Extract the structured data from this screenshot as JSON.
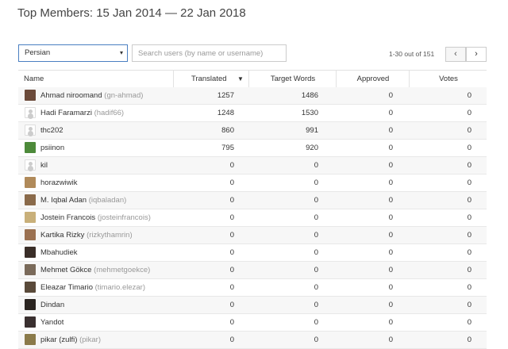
{
  "title": "Top Members: 15 Jan 2014 — 22 Jan 2018",
  "language_select": {
    "value": "Persian",
    "caret": "▾"
  },
  "search": {
    "placeholder": "Search users (by name or username)"
  },
  "pagination": {
    "text": "1-30 out of 151",
    "prev": "‹",
    "next": "›"
  },
  "columns": {
    "name": "Name",
    "translated": "Translated",
    "sort_indicator": "▼",
    "target_words": "Target Words",
    "approved": "Approved",
    "votes": "Votes"
  },
  "members": [
    {
      "name": "Ahmad niroomand",
      "username": "(gn-ahmad)",
      "translated": "1257",
      "target_words": "1486",
      "approved": "0",
      "votes": "0",
      "avatar_color": "#6b4a3a"
    },
    {
      "name": "Hadi Faramarzi",
      "username": "(hadif66)",
      "translated": "1248",
      "target_words": "1530",
      "approved": "0",
      "votes": "0",
      "avatar_color": "default"
    },
    {
      "name": "thc202",
      "username": "",
      "translated": "860",
      "target_words": "991",
      "approved": "0",
      "votes": "0",
      "avatar_color": "default"
    },
    {
      "name": "psiinon",
      "username": "",
      "translated": "795",
      "target_words": "920",
      "approved": "0",
      "votes": "0",
      "avatar_color": "#4d8a3a"
    },
    {
      "name": "kil",
      "username": "",
      "translated": "0",
      "target_words": "0",
      "approved": "0",
      "votes": "0",
      "avatar_color": "default"
    },
    {
      "name": "horazwiwik",
      "username": "",
      "translated": "0",
      "target_words": "0",
      "approved": "0",
      "votes": "0",
      "avatar_color": "#b08a5a"
    },
    {
      "name": "M. Iqbal Adan",
      "username": "(iqbaladan)",
      "translated": "0",
      "target_words": "0",
      "approved": "0",
      "votes": "0",
      "avatar_color": "#8a6a4a"
    },
    {
      "name": "Jostein Francois",
      "username": "(josteinfrancois)",
      "translated": "0",
      "target_words": "0",
      "approved": "0",
      "votes": "0",
      "avatar_color": "#c9b07a"
    },
    {
      "name": "Kartika Rizky",
      "username": "(rizkythamrin)",
      "translated": "0",
      "target_words": "0",
      "approved": "0",
      "votes": "0",
      "avatar_color": "#9a7050"
    },
    {
      "name": "Mbahudiek",
      "username": "",
      "translated": "0",
      "target_words": "0",
      "approved": "0",
      "votes": "0",
      "avatar_color": "#3a2e28"
    },
    {
      "name": "Mehmet Gökce",
      "username": "(mehmetgoekce)",
      "translated": "0",
      "target_words": "0",
      "approved": "0",
      "votes": "0",
      "avatar_color": "#7a6a5a"
    },
    {
      "name": "Eleazar Timario",
      "username": "(timario.elezar)",
      "translated": "0",
      "target_words": "0",
      "approved": "0",
      "votes": "0",
      "avatar_color": "#5a4a3a"
    },
    {
      "name": "Dindan",
      "username": "",
      "translated": "0",
      "target_words": "0",
      "approved": "0",
      "votes": "0",
      "avatar_color": "#2a2420"
    },
    {
      "name": "Yandot",
      "username": "",
      "translated": "0",
      "target_words": "0",
      "approved": "0",
      "votes": "0",
      "avatar_color": "#3a3030"
    },
    {
      "name": "pikar (zulfi)",
      "username": "(pikar)",
      "translated": "0",
      "target_words": "0",
      "approved": "0",
      "votes": "0",
      "avatar_color": "#8a7a4a"
    }
  ]
}
